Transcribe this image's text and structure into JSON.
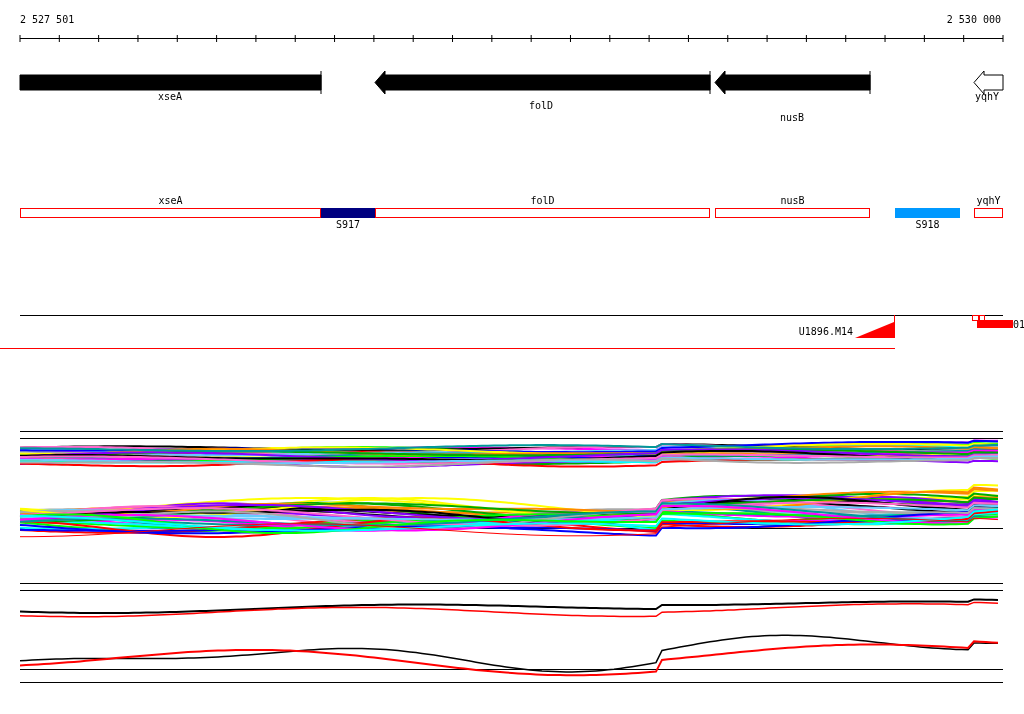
{
  "ruler": {
    "start_label": "2 527 501",
    "end_label": "2 530 000"
  },
  "genes": [
    {
      "label": "xseA",
      "head": false,
      "filled": true
    },
    {
      "label": "folD",
      "head": true,
      "filled": true
    },
    {
      "label": "nusB",
      "head": true,
      "filled": true
    },
    {
      "label": "yqhY",
      "head": true,
      "filled": false
    }
  ],
  "annotations": [
    {
      "kind": "gene",
      "label": "xseA"
    },
    {
      "kind": "site",
      "label": "S917",
      "color": "#000080"
    },
    {
      "kind": "gene",
      "label": "folD"
    },
    {
      "kind": "gene",
      "label": "nusB"
    },
    {
      "kind": "site",
      "label": "S918",
      "color": "#0099ff"
    },
    {
      "kind": "gene",
      "label": "yqhY"
    }
  ],
  "probe_track": {
    "probes": [
      {
        "label": "U1896.M14"
      },
      {
        "label": "01"
      }
    ]
  }
}
